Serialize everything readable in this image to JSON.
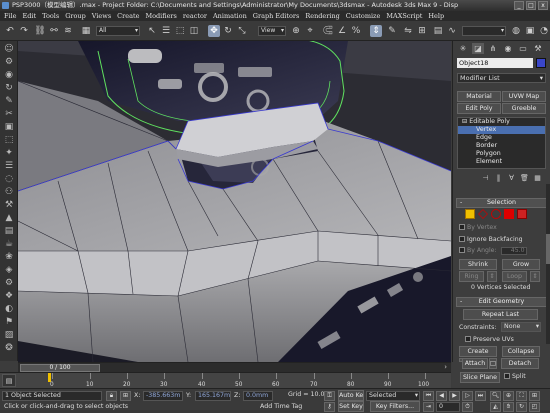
{
  "window": {
    "title": "PSP3000（模型编辑）.max   - Project Folder: C:\\Documents and Settings\\Administrator\\My Documents\\3dsmax     - Autodesk 3ds Max 9     - Disp",
    "buttons": [
      "_",
      "□",
      "x"
    ]
  },
  "menu": [
    "File",
    "Edit",
    "Tools",
    "Group",
    "Views",
    "Create",
    "Modifiers",
    "reactor",
    "Animation",
    "Graph Editors",
    "Rendering",
    "Customize",
    "MAXScript",
    "Help"
  ],
  "toolbar": {
    "filter_value": "All",
    "refcoord_value": "View"
  },
  "panel": {
    "object_name": "Object18",
    "object_color": "#3a46c8",
    "modifier_list_label": "Modifier List",
    "buttons": {
      "material": "Material",
      "uvw_map": "UVW Map",
      "edit_poly": "Edit Poly",
      "greeble": "Greeble"
    },
    "stack": {
      "items": [
        "Editable Poly",
        "Vertex",
        "Edge",
        "Border",
        "Polygon",
        "Element"
      ],
      "selected": "Vertex"
    },
    "selection": {
      "title": "Selection",
      "by_vertex": "By Vertex",
      "ignore_backfacing": "Ignore Backfacing",
      "by_angle": "By Angle:",
      "by_angle_value": "45.0",
      "shrink": "Shrink",
      "grow": "Grow",
      "ring": "Ring",
      "loop": "Loop",
      "status": "0 Vertices Selected"
    },
    "edit_geometry": {
      "title": "Edit Geometry",
      "repeat_last": "Repeat Last",
      "constraints_label": "Constraints:",
      "constraints_value": "None",
      "preserve_uvs": "Preserve UVs",
      "create": "Create",
      "collapse": "Collapse",
      "attach": "Attach",
      "detach": "Detach",
      "slice_plane": "Slice Plane",
      "split": "Split"
    }
  },
  "timeline": {
    "frame_label": "0 / 100",
    "ticks": [
      "0",
      "10",
      "20",
      "30",
      "40",
      "50",
      "60",
      "70",
      "80",
      "90",
      "100"
    ]
  },
  "status": {
    "objects_selected": "1 Object Selected",
    "prompt": "Click or click-and-drag to select objects",
    "x_label": "X:",
    "x_value": "-385.663m",
    "y_label": "Y:",
    "y_value": "165.167m",
    "z_label": "Z:",
    "z_value": "0.0mm",
    "grid": "Grid = 10.0mm",
    "add_time_tag": "Add Time Tag",
    "auto_key": "Auto Key",
    "auto_key_value": "Selected",
    "set_key": "Set Key",
    "key_filters": "Key Filters...",
    "frame_value": "0"
  },
  "left_tools": [
    "☺",
    "⚙",
    "◉",
    "↻",
    "✎",
    "✂",
    "▣",
    "⬚",
    "✦",
    "☰",
    "◌",
    "⚇",
    "⚒",
    "▲",
    "▤",
    "☕",
    "❀",
    "◈",
    "⚙",
    "❖",
    "◐",
    "⚑",
    "▨",
    "❂"
  ]
}
